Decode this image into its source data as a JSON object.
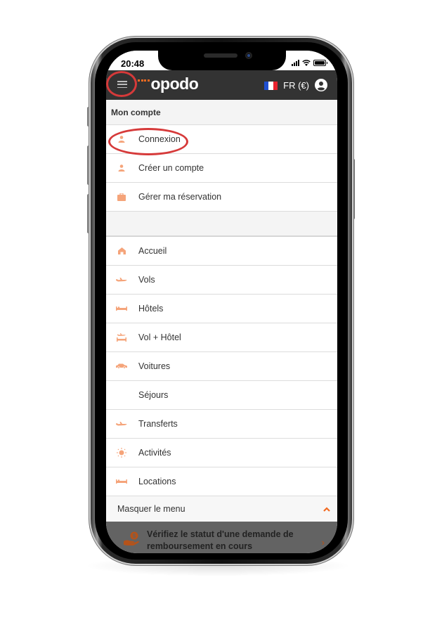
{
  "status_bar": {
    "time": "20:48"
  },
  "header": {
    "logo": "opodo",
    "language": "FR (€)",
    "brand_color": "#f26a21",
    "header_color": "#333333",
    "flag_colors": [
      "#1f4fd1",
      "#ffffff",
      "#e8232e"
    ]
  },
  "menu": {
    "account_section_title": "Mon compte",
    "account_items": [
      {
        "label": "Connexion",
        "icon": "user-icon"
      },
      {
        "label": "Créer un compte",
        "icon": "user-icon"
      },
      {
        "label": "Gérer ma réservation",
        "icon": "briefcase-icon"
      }
    ],
    "nav_items": [
      {
        "label": "Accueil",
        "icon": "home-icon"
      },
      {
        "label": "Vols",
        "icon": "plane-icon"
      },
      {
        "label": "Hôtels",
        "icon": "bed-icon"
      },
      {
        "label": "Vol + Hôtel",
        "icon": "plane-bed-icon"
      },
      {
        "label": "Voitures",
        "icon": "car-icon"
      },
      {
        "label": "Séjours",
        "icon": ""
      },
      {
        "label": "Transferts",
        "icon": "plane-icon"
      },
      {
        "label": "Activités",
        "icon": "sun-icon"
      },
      {
        "label": "Locations",
        "icon": "bed-icon"
      }
    ],
    "collapse_label": "Masquer le menu",
    "icon_color": "#f5a47a"
  },
  "refund_banner": {
    "text": "Vérifiez le statut d'une demande de remboursement en cours",
    "icon": "money-hand-icon"
  },
  "annotations": {
    "highlight_color": "#d63a3a"
  }
}
